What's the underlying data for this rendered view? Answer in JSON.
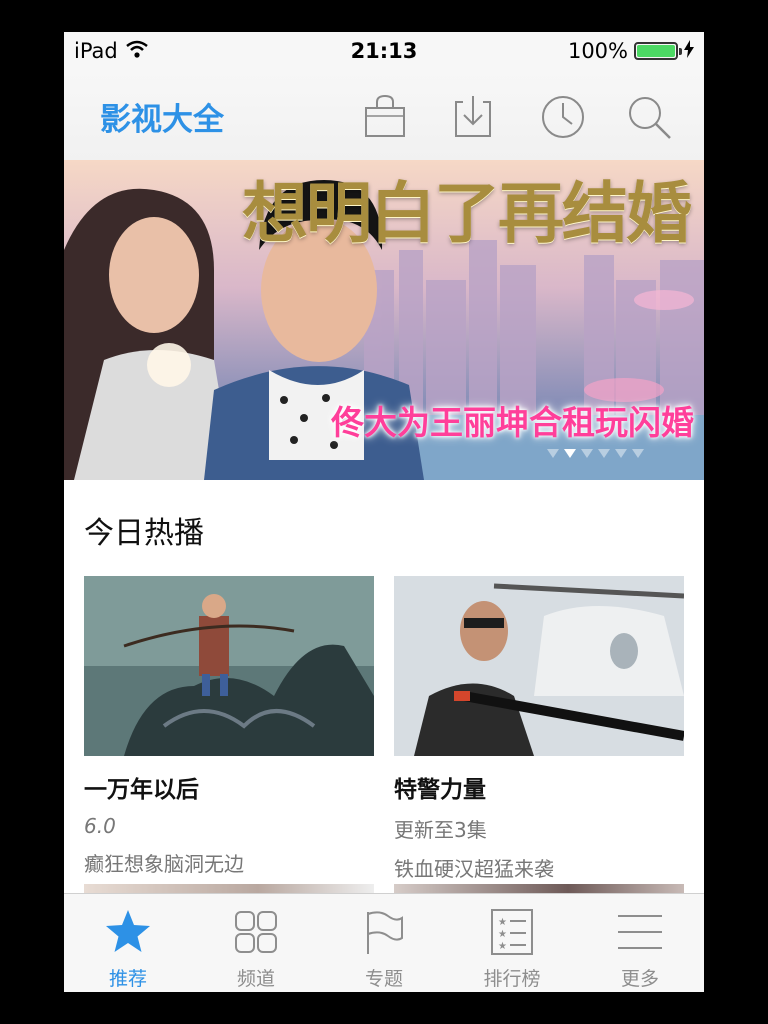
{
  "status_bar": {
    "device": "iPad",
    "time": "21:13",
    "battery": "100%",
    "battery_level": 1.0
  },
  "nav": {
    "title": "影视大全",
    "icons": [
      "bag-icon",
      "download-icon",
      "history-icon",
      "search-icon"
    ]
  },
  "banner": {
    "title": "想明白了再结婚",
    "subtitle": "佟大为王丽坤合租玩闪婚",
    "page_count": 6,
    "active_page": 1
  },
  "section": {
    "title": "今日热播"
  },
  "cards": [
    {
      "title": "一万年以后",
      "meta": "6.0",
      "desc": "癫狂想象脑洞无边"
    },
    {
      "title": "特警力量",
      "meta": "更新至3集",
      "desc": "铁血硬汉超猛来袭"
    }
  ],
  "tabs": [
    {
      "label": "推荐",
      "icon": "star-icon",
      "active": true
    },
    {
      "label": "频道",
      "icon": "grid-icon",
      "active": false
    },
    {
      "label": "专题",
      "icon": "flag-icon",
      "active": false
    },
    {
      "label": "排行榜",
      "icon": "ranking-list-icon",
      "active": false
    },
    {
      "label": "更多",
      "icon": "more-menu-icon",
      "active": false
    }
  ],
  "colors": {
    "accent": "#2d91e6",
    "banner_text": "#ff3f9a",
    "battery": "#4cd964"
  }
}
